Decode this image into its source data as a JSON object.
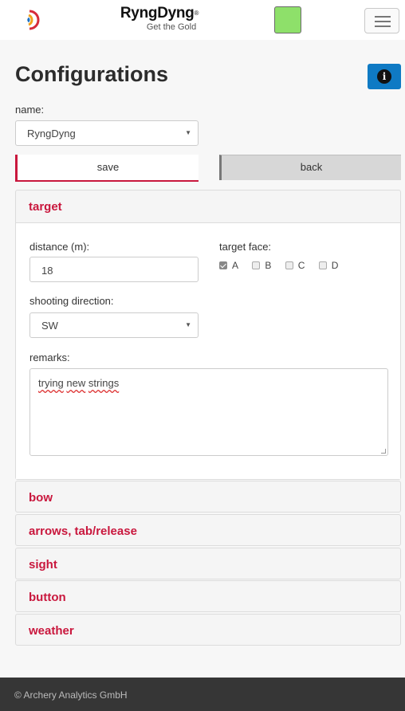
{
  "header": {
    "brand_name": "RyngDyng",
    "brand_tagline": "Get the Gold",
    "brand_reg_mark": "®",
    "status_color": "#8ee06a",
    "icons": [
      "logo-icon",
      "hamburger-menu-icon"
    ]
  },
  "page": {
    "title": "Configurations",
    "info_icon": "i"
  },
  "config": {
    "name_label": "name:",
    "name_value": "RyngDyng",
    "save_label": "save",
    "back_label": "back"
  },
  "target": {
    "title": "target",
    "distance_label": "distance (m):",
    "distance_value": "18",
    "face_label": "target face:",
    "faces": [
      {
        "label": "A",
        "checked": true
      },
      {
        "label": "B",
        "checked": false
      },
      {
        "label": "C",
        "checked": false
      },
      {
        "label": "D",
        "checked": false
      }
    ],
    "direction_label": "shooting direction:",
    "direction_value": "SW",
    "remarks_label": "remarks:",
    "remarks_words": [
      "trying",
      "new",
      "strings"
    ]
  },
  "sections": [
    "bow",
    "arrows, tab/release",
    "sight",
    "button",
    "weather"
  ],
  "footer": {
    "text": "© Archery Analytics GmbH"
  },
  "colors": {
    "accent": "#c9173d",
    "info_button": "#0f7ac4"
  }
}
